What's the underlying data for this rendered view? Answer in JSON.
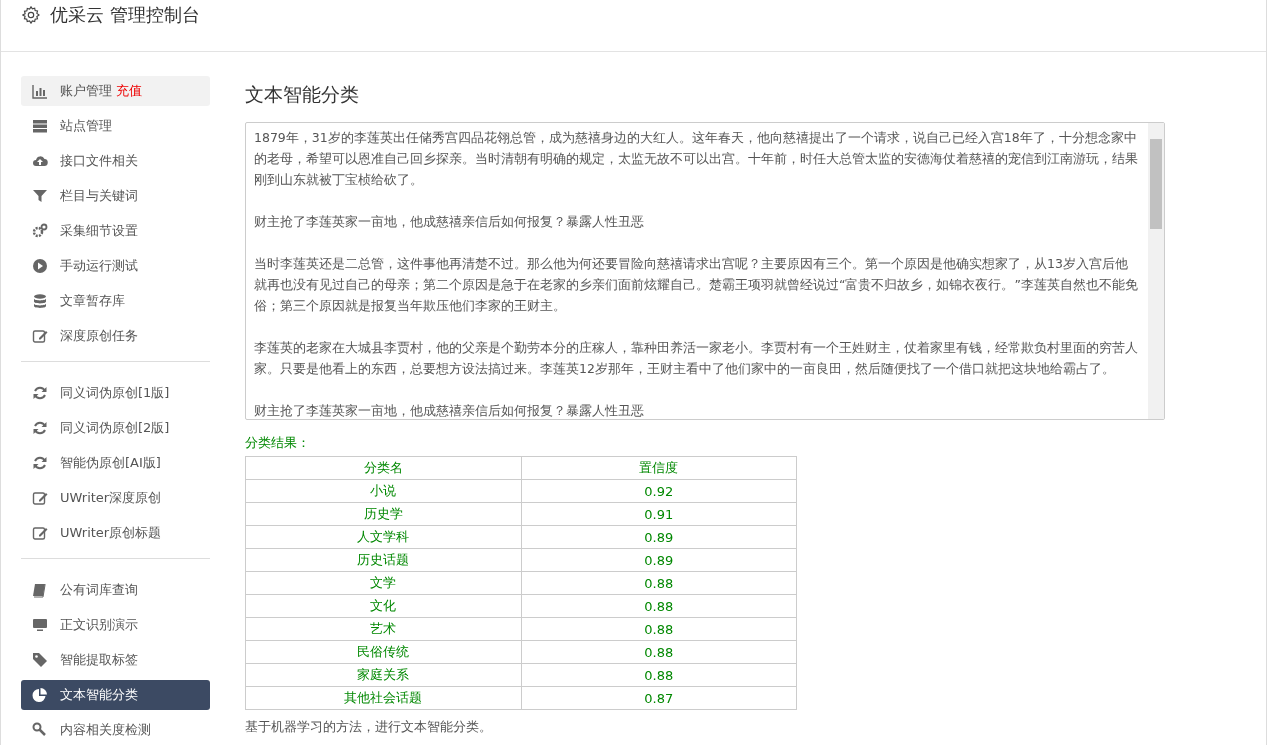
{
  "header": {
    "title": "优采云 管理控制台"
  },
  "sidebar": {
    "groups": [
      [
        {
          "label": "账户管理",
          "badge": "充值",
          "selected": false
        },
        {
          "label": "站点管理",
          "selected": false
        },
        {
          "label": "接口文件相关",
          "selected": false
        },
        {
          "label": "栏目与关键词",
          "selected": false
        },
        {
          "label": "采集细节设置",
          "selected": false
        },
        {
          "label": "手动运行测试",
          "selected": false
        },
        {
          "label": "文章暂存库",
          "selected": false
        },
        {
          "label": "深度原创任务",
          "selected": false
        }
      ],
      [
        {
          "label": "同义词伪原创[1版]",
          "selected": false
        },
        {
          "label": "同义词伪原创[2版]",
          "selected": false
        },
        {
          "label": "智能伪原创[AI版]",
          "selected": false
        },
        {
          "label": "UWriter深度原创",
          "selected": false
        },
        {
          "label": "UWriter原创标题",
          "selected": false
        }
      ],
      [
        {
          "label": "公有词库查询",
          "selected": false
        },
        {
          "label": "正文识别演示",
          "selected": false
        },
        {
          "label": "智能提取标签",
          "selected": false
        },
        {
          "label": "文本智能分类",
          "selected": true
        },
        {
          "label": "内容相关度检测",
          "selected": false
        }
      ]
    ]
  },
  "main": {
    "title": "文本智能分类",
    "input_paragraphs": [
      "1879年，31岁的李莲英出任储秀宫四品花翎总管，成为慈禧身边的大红人。这年春天，他向慈禧提出了一个请求，说自己已经入宫18年了，十分想念家中的老母，希望可以恩准自己回乡探亲。当时清朝有明确的规定，太监无故不可以出宫。十年前，时任大总管太监的安德海仗着慈禧的宠信到江南游玩，结果刚到山东就被丁宝桢给砍了。",
      "财主抢了李莲英家一亩地，他成慈禧亲信后如何报复？暴露人性丑恶",
      "当时李莲英还是二总管，这件事他再清楚不过。那么他为何还要冒险向慈禧请求出宫呢？主要原因有三个。第一个原因是他确实想家了，从13岁入宫后他就再也没有见过自己的母亲；第二个原因是急于在老家的乡亲们面前炫耀自己。楚霸王项羽就曾经说过“富贵不归故乡，如锦衣夜行。”李莲英自然也不能免俗；第三个原因就是报复当年欺压他们李家的王财主。",
      "李莲英的老家在大城县李贾村，他的父亲是个勤劳本分的庄稼人，靠种田养活一家老小。李贾村有一个王姓财主，仗着家里有钱，经常欺负村里面的穷苦人家。只要是他看上的东西，总要想方设法搞过来。李莲英12岁那年，王财主看中了他们家中的一亩良田，然后随便找了一个借口就把这块地给霸占了。",
      "财主抢了李莲英家一亩地，他成慈禧亲信后如何报复？暴露人性丑恶"
    ],
    "result_label": "分类结果：",
    "table": {
      "columns": [
        "分类名",
        "置信度"
      ],
      "rows": [
        [
          "小说",
          "0.92"
        ],
        [
          "历史学",
          "0.91"
        ],
        [
          "人文学科",
          "0.89"
        ],
        [
          "历史话题",
          "0.89"
        ],
        [
          "文学",
          "0.88"
        ],
        [
          "文化",
          "0.88"
        ],
        [
          "艺术",
          "0.88"
        ],
        [
          "民俗传统",
          "0.88"
        ],
        [
          "家庭关系",
          "0.88"
        ],
        [
          "其他社会话题",
          "0.87"
        ]
      ]
    },
    "footnote": "基于机器学习的方法，进行文本智能分类。"
  }
}
